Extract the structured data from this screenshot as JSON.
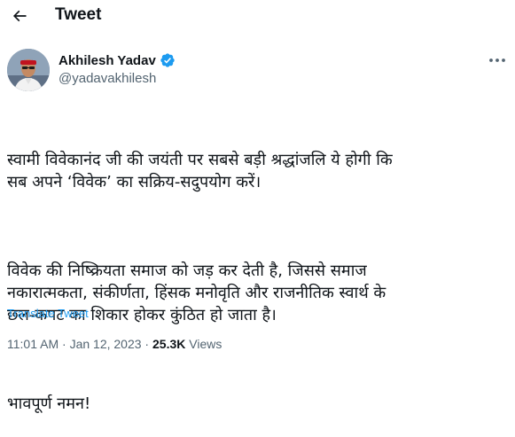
{
  "header": {
    "title": "Tweet",
    "back_icon": "arrow-left-icon"
  },
  "author": {
    "name": "Akhilesh Yadav",
    "handle": "@yadavakhilesh",
    "verified_icon": "verified-badge-icon",
    "verified_color": "#1d9bf0"
  },
  "tweet": {
    "paragraphs": [
      "स्वामी विवेकानंद जी की जयंती पर सबसे बड़ी श्रद्धांजलि ये होगी कि\nसब अपने ‘विवेक’ का सक्रिय-सदुपयोग करें।",
      "विवेक की निष्क्रियता समाज को जड़ कर देती है, जिससे समाज\nनकारात्मकता, संकीर्णता, हिंसक मनोवृति और राजनीतिक स्वार्थ के\nछल-कपट का शिकार होकर कुंठित हो जाता है।",
      "भावपूर्ण नमन!"
    ],
    "translate_label": "Translate Tweet"
  },
  "meta": {
    "time": "11:01 AM",
    "separator": " · ",
    "date": "Jan 12, 2023",
    "views_count": "25.3K",
    "views_label": " Views"
  },
  "colors": {
    "link": "#1d9bf0",
    "secondary_text": "#536471",
    "primary_text": "#0f1419"
  }
}
